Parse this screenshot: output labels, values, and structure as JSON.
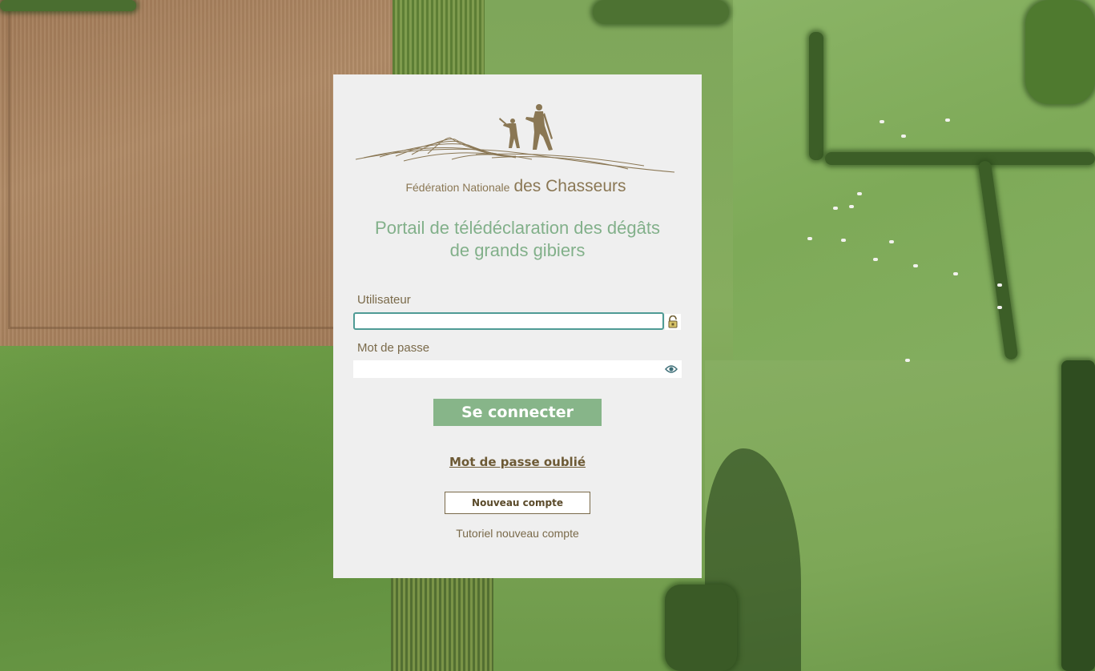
{
  "logo": {
    "text_small": "Fédération Nationale",
    "text_large": "des Chasseurs"
  },
  "portal": {
    "title_line1": "Portail de télédéclaration des dégâts",
    "title_line2": "de grands gibiers"
  },
  "form": {
    "username_label": "Utilisateur",
    "username_value": "",
    "password_label": "Mot de passe",
    "password_value": "",
    "submit_label": "Se connecter",
    "forgot_password_label": "Mot de passe oublié",
    "new_account_label": "Nouveau compte",
    "tutorial_label": "Tutoriel nouveau compte"
  },
  "icons": {
    "username_field": "lock-icon",
    "password_field": "eye-icon"
  },
  "colors": {
    "panel_background": "#efefef",
    "title_green": "#82b08a",
    "button_green": "#87b589",
    "brown_text": "#7a6a4a",
    "logo_gold": "#8a7754",
    "input_focus_border": "#4f9b95"
  }
}
